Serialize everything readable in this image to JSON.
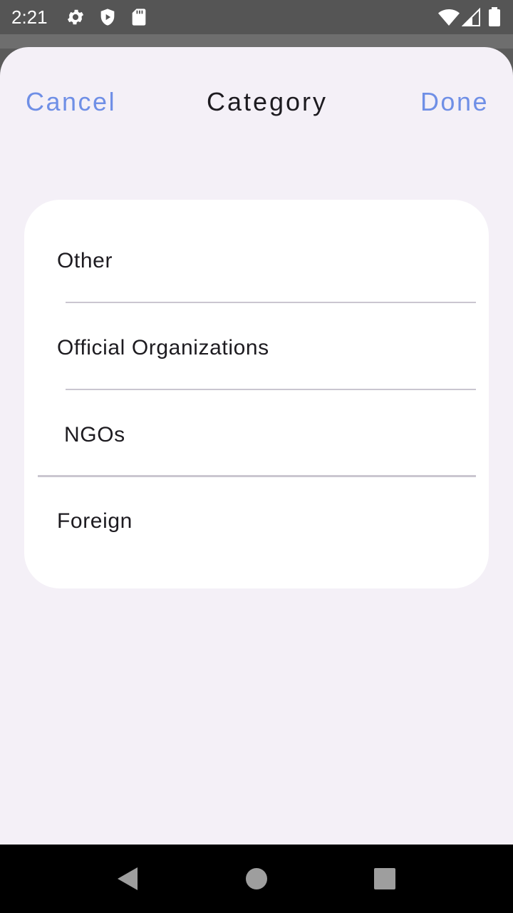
{
  "status_bar": {
    "time": "2:21",
    "icons": [
      "gear-icon",
      "shield-icon",
      "sd-card-icon",
      "wifi-icon",
      "cell-signal-icon",
      "battery-icon"
    ]
  },
  "sheet": {
    "cancel_label": "Cancel",
    "title": "Category",
    "done_label": "Done",
    "accent_color": "#6f8fe6",
    "background_color": "#f4f0f7"
  },
  "options": [
    {
      "label": "Other"
    },
    {
      "label": "Official Organizations"
    },
    {
      "label": "NGOs"
    },
    {
      "label": "Foreign"
    }
  ],
  "nav_bar": {
    "icons": [
      "back-icon",
      "home-icon",
      "recents-icon"
    ]
  }
}
